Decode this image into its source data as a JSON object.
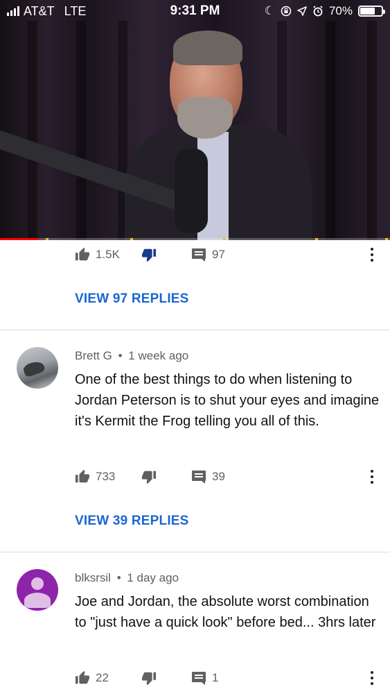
{
  "status_bar": {
    "carrier": "AT&T",
    "network": "LTE",
    "time": "9:31 PM",
    "battery_percent": "70%",
    "battery_level": 0.7,
    "icons": [
      "moon-icon",
      "rotation-lock-icon",
      "location-arrow-icon",
      "alarm-icon"
    ]
  },
  "video": {
    "progress_fraction": 0.1,
    "colors": {
      "played": "#ff0000",
      "ad_marker": "#f2c21b"
    }
  },
  "top_comment": {
    "likes": "1.5K",
    "replies_count": "97",
    "view_replies": "VIEW 97 REPLIES"
  },
  "comments": [
    {
      "author": "Brett G",
      "time": "1 week ago",
      "text": "One of the best things to do when listening to Jordan Peterson is to shut your eyes and imagine it's Kermit the Frog telling you all of this.",
      "likes": "733",
      "replies_count": "39",
      "view_replies": "VIEW 39 REPLIES",
      "avatar": "photo-avatar"
    },
    {
      "author": "blksrsil",
      "time": "1 day ago",
      "text": "Joe and Jordan, the absolute worst combination to \"just have a quick look\" before bed... 3hrs later",
      "likes": "22",
      "replies_count": "1",
      "avatar": "default-avatar"
    }
  ],
  "colors": {
    "link_blue": "#1a66d2",
    "meta_gray": "#606060",
    "default_avatar_purple": "#8e24aa"
  },
  "separator": "•"
}
